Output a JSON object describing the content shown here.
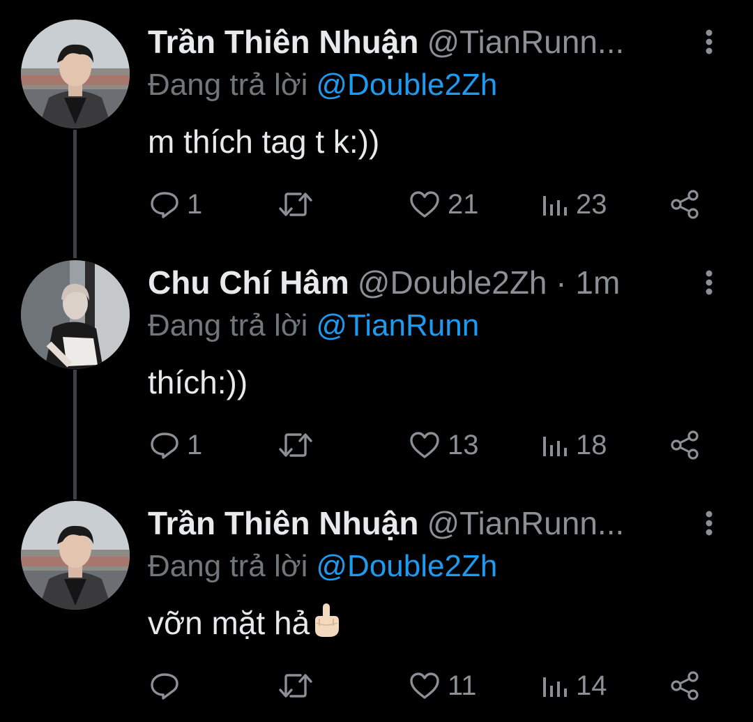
{
  "tweets": [
    {
      "display_name": "Trần Thiên Nhuận",
      "handle": "@TianRunn...",
      "reply_prefix": "Đang trả lời",
      "reply_to": "@Double2Zh",
      "text": "m thích tag t k:))",
      "emoji": "",
      "replies": "1",
      "retweets": "",
      "likes": "21",
      "views": "23",
      "avatar_icon": "profile-photo-icon"
    },
    {
      "display_name": "Chu Chí Hâm",
      "handle": "@Double2Zh · 1m",
      "reply_prefix": "Đang trả lời",
      "reply_to": "@TianRunn",
      "text": "thích:))",
      "emoji": "",
      "replies": "1",
      "retweets": "",
      "likes": "13",
      "views": "18",
      "avatar_icon": "profile-photo-icon"
    },
    {
      "display_name": "Trần Thiên Nhuận",
      "handle": "@TianRunn...",
      "reply_prefix": "Đang trả lời",
      "reply_to": "@Double2Zh",
      "text": "vỡn mặt hả",
      "emoji": "middle-finger",
      "replies": "",
      "retweets": "",
      "likes": "11",
      "views": "14",
      "avatar_icon": "profile-photo-icon"
    }
  ],
  "colors": {
    "background": "#000000",
    "text": "#e7e9ea",
    "muted": "#71767b",
    "mention": "#1d9bf0",
    "thread_line": "#3e4144"
  }
}
